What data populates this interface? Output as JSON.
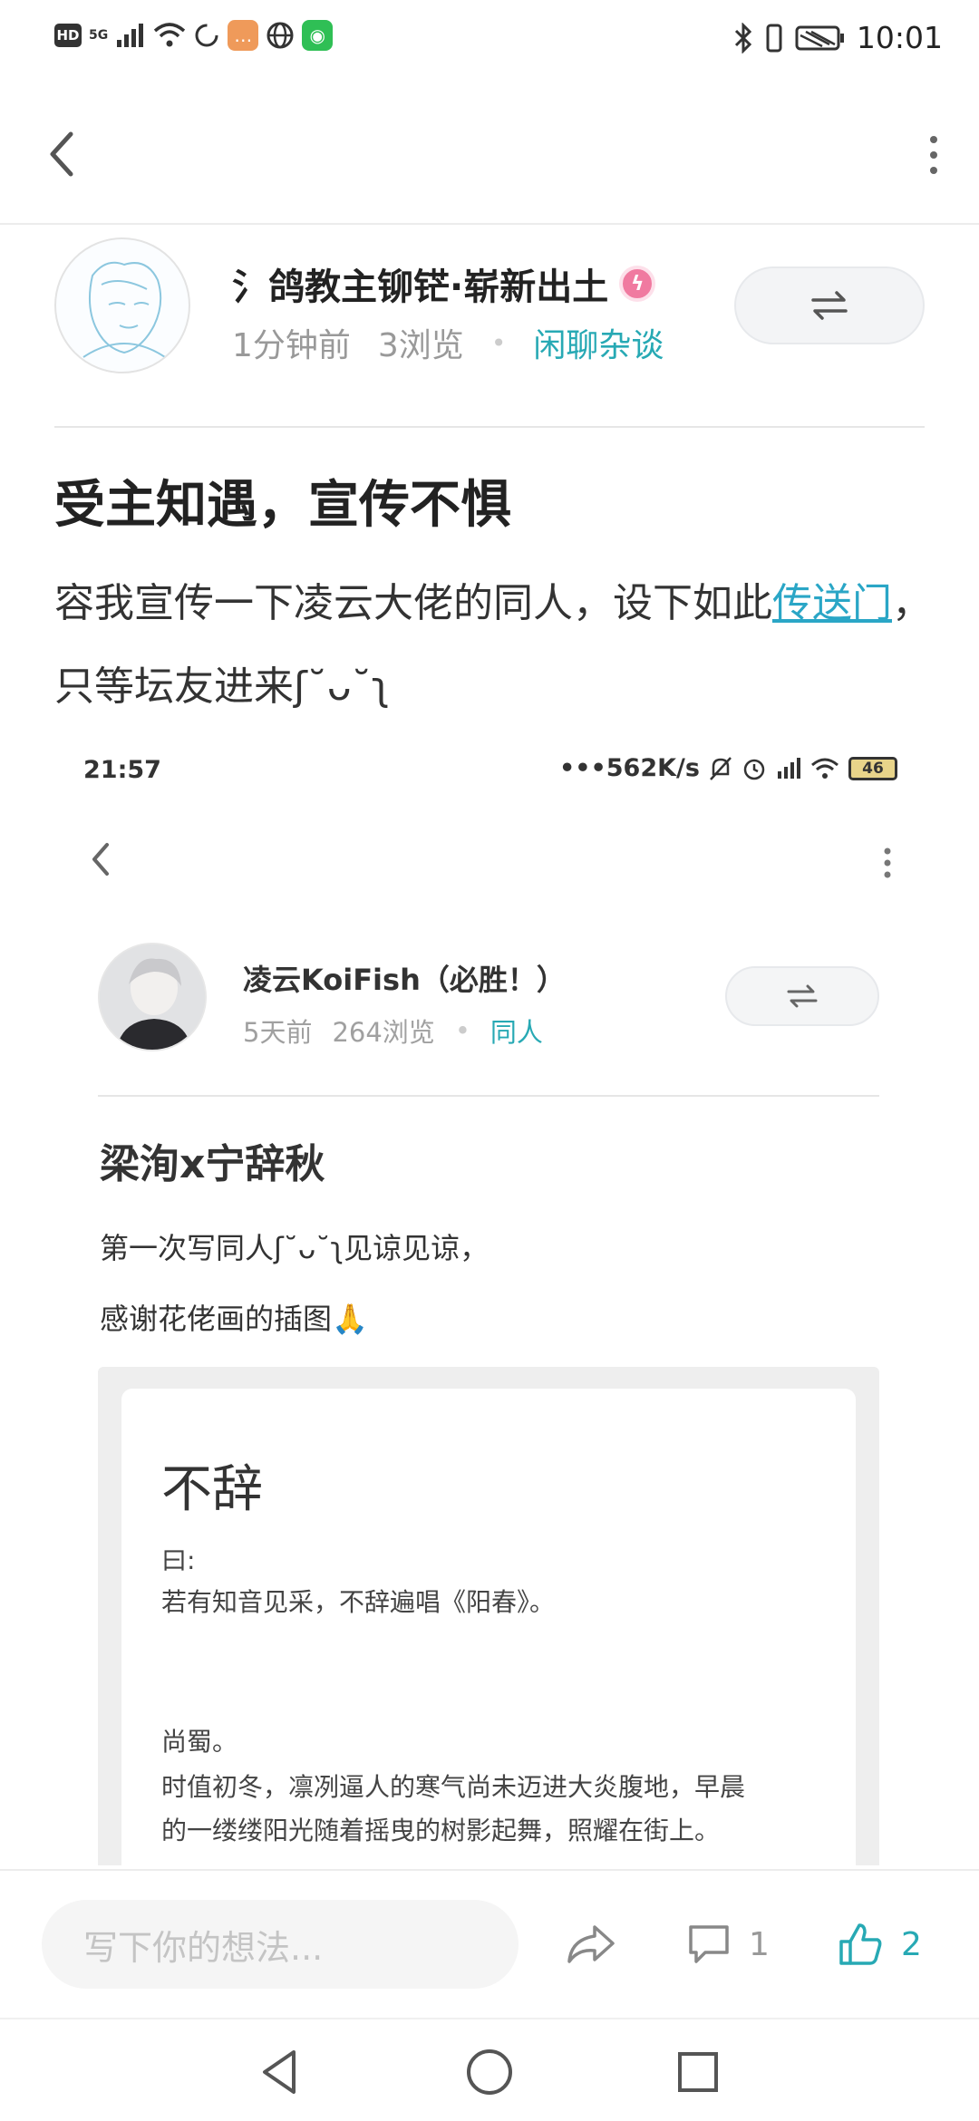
{
  "status_bar": {
    "left_badge": "HD",
    "network": "5G",
    "time": "10:01"
  },
  "author": {
    "name": "氵鸽教主铆铓·崭新出土",
    "time_ago": "1分钟前",
    "views": "3浏览",
    "category": "闲聊杂谈"
  },
  "post": {
    "title": "受主知遇，宣传不惧",
    "body_before_link": "容我宣传一下凌云大佬的同人，设下如此",
    "link_text": "传送门",
    "body_after_link": "，只等坛友进来ʃ˘ᴗ˘ʅ"
  },
  "embedded": {
    "time": "21:57",
    "net_speed": "•••562K/s",
    "battery": "46",
    "author_name": "凌云KoiFish（必胜！）",
    "time_ago": "5天前",
    "views": "264浏览",
    "category": "同人",
    "title": "梁洵x宁辞秋",
    "body_line1": "第一次写同人ʃ˘ᴗ˘ʅ见谅见谅，",
    "body_line2": "感谢花佬画的插图🙏",
    "card": {
      "title": "不辞",
      "line1": "曰:",
      "line2": "若有知音见采，不辞遍唱《阳春》。",
      "line3": "尚蜀。",
      "line4": "时值初冬，凛冽逼人的寒气尚未迈进大炎腹地，早晨",
      "line5": "的一缕缕阳光随着摇曳的树影起舞，照耀在街上。"
    }
  },
  "bottom_bar": {
    "input_placeholder": "写下你的想法...",
    "comment_count": "1",
    "like_count": "2"
  },
  "colors": {
    "accent": "#27a9b4",
    "link": "#2aa6c6",
    "badge": "#f07aa0"
  }
}
